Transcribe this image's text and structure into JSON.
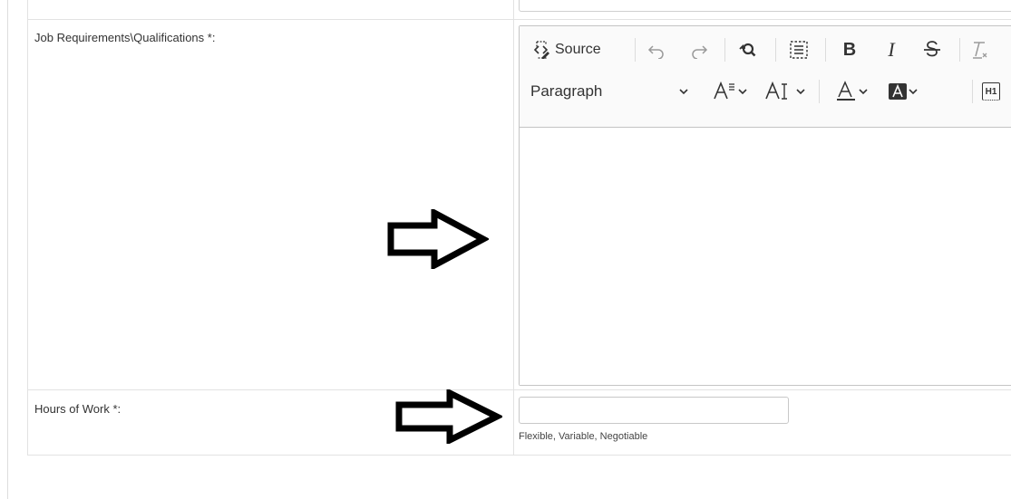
{
  "form": {
    "job_requirements": {
      "label": "Job Requirements\\Qualifications *:"
    },
    "hours_of_work": {
      "label": "Hours of Work *:",
      "value": "",
      "hint": "Flexible, Variable, Negotiable"
    }
  },
  "editor": {
    "source_label": "Source",
    "paragraph_label": "Paragraph",
    "bold_glyph": "B",
    "italic_glyph": "I",
    "heading_badge": "H1"
  },
  "icons": [
    "source-icon",
    "undo-icon",
    "redo-icon",
    "find-replace-icon",
    "select-all-icon",
    "bold-icon",
    "italic-icon",
    "strikethrough-icon",
    "remove-format-icon",
    "chevron-down-icon",
    "font-size-icon",
    "font-family-icon",
    "font-color-icon",
    "font-background-color-icon",
    "heading-icon",
    "arrow-right-icon"
  ]
}
